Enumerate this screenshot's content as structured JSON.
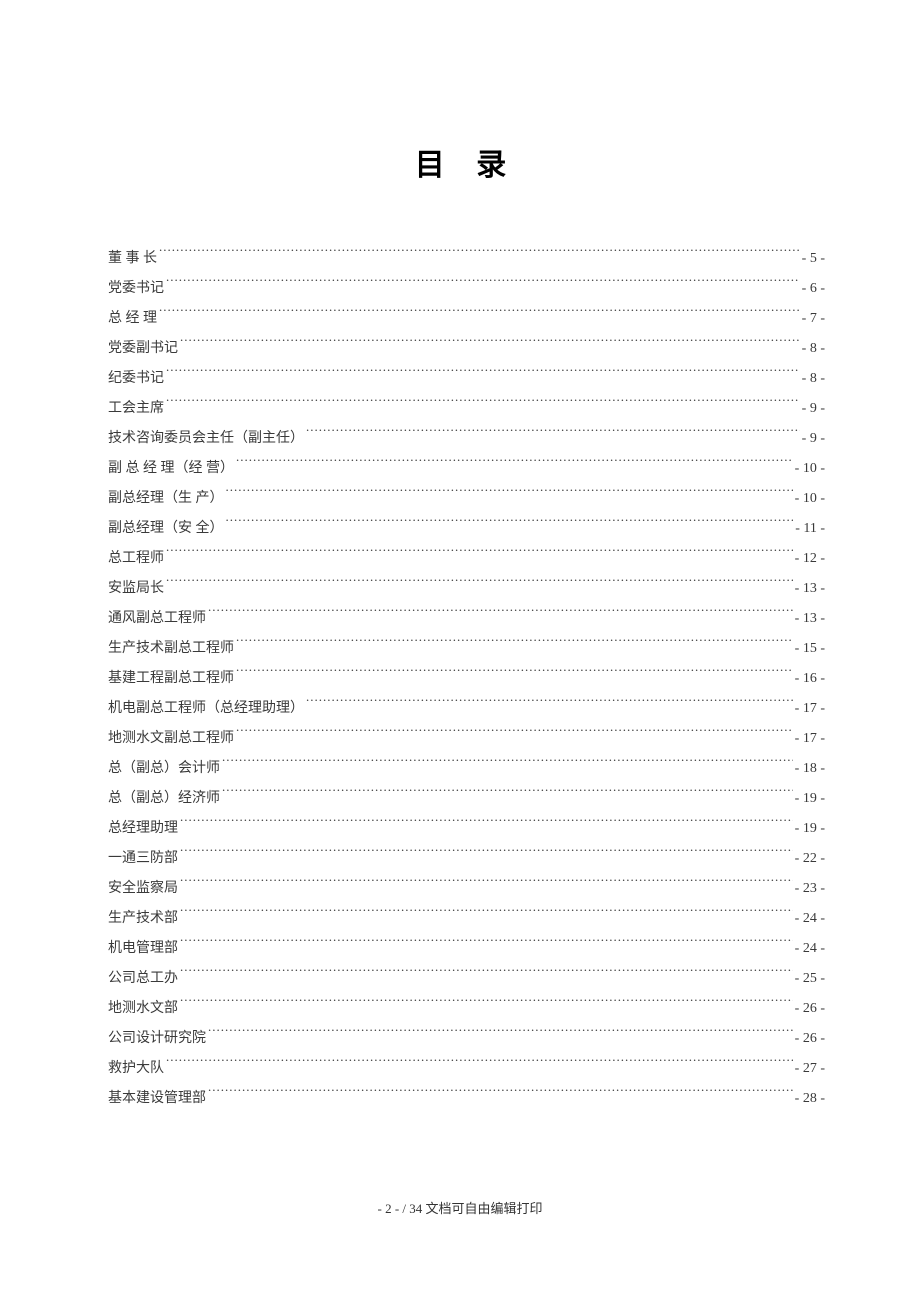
{
  "title": "目 录",
  "toc": [
    {
      "label": "董 事 长",
      "page": "- 5 -"
    },
    {
      "label": "党委书记",
      "page": "- 6 -"
    },
    {
      "label": "总 经 理",
      "page": "- 7 -"
    },
    {
      "label": "党委副书记",
      "page": "- 8 -"
    },
    {
      "label": "纪委书记",
      "page": "- 8 -"
    },
    {
      "label": "工会主席",
      "page": "- 9 -"
    },
    {
      "label": "技术咨询委员会主任（副主任）",
      "page": "- 9 -"
    },
    {
      "label": "副 总 经 理（经 营）",
      "page": "- 10 -"
    },
    {
      "label": "副总经理（生 产）",
      "page": "- 10 -"
    },
    {
      "label": "副总经理（安 全）",
      "page": "- 11 -"
    },
    {
      "label": "总工程师",
      "page": "- 12 -"
    },
    {
      "label": "安监局长",
      "page": "- 13 -"
    },
    {
      "label": "通风副总工程师",
      "page": "- 13 -"
    },
    {
      "label": "生产技术副总工程师",
      "page": "- 15 -"
    },
    {
      "label": "基建工程副总工程师",
      "page": "- 16 -"
    },
    {
      "label": "机电副总工程师（总经理助理）",
      "page": "- 17 -"
    },
    {
      "label": "地测水文副总工程师",
      "page": "- 17 -"
    },
    {
      "label": "总（副总）会计师",
      "page": "- 18 -"
    },
    {
      "label": "总（副总）经济师",
      "page": "- 19 -"
    },
    {
      "label": "总经理助理",
      "page": "- 19 -"
    },
    {
      "label": "一通三防部",
      "page": "- 22 -"
    },
    {
      "label": "安全监察局",
      "page": "- 23 -"
    },
    {
      "label": "生产技术部",
      "page": "- 24 -"
    },
    {
      "label": "机电管理部",
      "page": "- 24 -"
    },
    {
      "label": "公司总工办",
      "page": "- 25 -"
    },
    {
      "label": "地测水文部",
      "page": "- 26 -"
    },
    {
      "label": "公司设计研究院",
      "page": "- 26 -"
    },
    {
      "label": "救护大队",
      "page": "- 27 -"
    },
    {
      "label": "基本建设管理部",
      "page": "- 28 -"
    }
  ],
  "footer": "- 2 -  /  34 文档可自由编辑打印"
}
